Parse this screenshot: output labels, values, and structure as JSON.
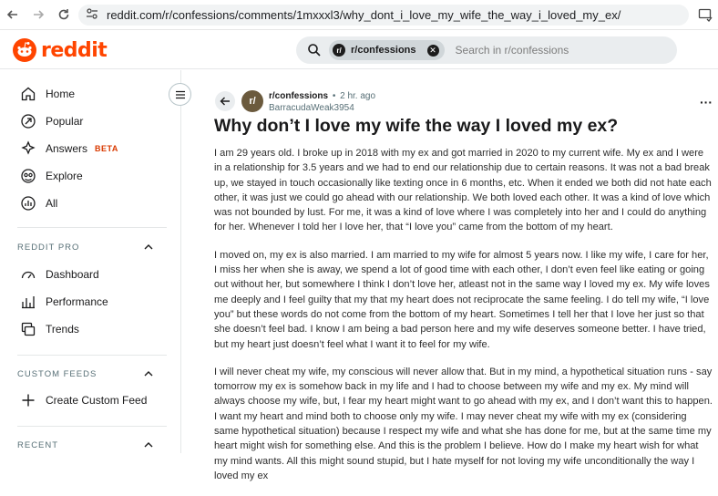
{
  "browser": {
    "url": "reddit.com/r/confessions/comments/1mxxxl3/why_dont_i_love_my_wife_the_way_i_loved_my_ex/"
  },
  "header": {
    "logo_text": "reddit",
    "search_chip": "r/confessions",
    "search_placeholder": "Search in r/confessions",
    "brand_color": "#ff4500"
  },
  "sidebar": {
    "nav": [
      {
        "label": "Home",
        "icon": "home-icon"
      },
      {
        "label": "Popular",
        "icon": "popular-icon"
      },
      {
        "label": "Answers",
        "icon": "answers-icon",
        "badge": "BETA"
      },
      {
        "label": "Explore",
        "icon": "explore-icon"
      },
      {
        "label": "All",
        "icon": "all-icon"
      }
    ],
    "sections": {
      "reddit_pro": {
        "title": "REDDIT PRO",
        "items": [
          {
            "label": "Dashboard",
            "icon": "dashboard-icon"
          },
          {
            "label": "Performance",
            "icon": "performance-icon"
          },
          {
            "label": "Trends",
            "icon": "trends-icon"
          }
        ]
      },
      "custom_feeds": {
        "title": "CUSTOM FEEDS",
        "items": [
          {
            "label": "Create Custom Feed",
            "icon": "plus-icon"
          }
        ]
      },
      "recent": {
        "title": "RECENT"
      }
    }
  },
  "post": {
    "subreddit": "r/confessions",
    "separator": "•",
    "age": "2 hr. ago",
    "author": "BarracudaWeak3954",
    "title": "Why don’t I love my wife the way I loved my ex?",
    "paragraphs": [
      "I am 29 years old. I broke up in 2018 with my ex and got married in 2020 to my current wife. My ex and I were in a relationship for 3.5 years and we had to end our relationship due to certain reasons. It was not a bad break up, we stayed in touch occasionally like texting once in 6 months, etc. When it ended we both did not hate each other, it was just we could go ahead with our relationship. We both loved each other. It was a kind of love which was not bounded by lust. For me, it was a kind of love where I was completely into her and I could do anything for her. Whenever I told her I love her, that “I love you” came from the bottom of my heart.",
      "I moved on, my ex is also married. I am married to my wife for almost 5 years now. I like my wife, I care for her, I miss her when she is away, we spend a lot of good time with each other, I don’t even feel like eating or going out without her, but somewhere I think I don’t love her, atleast not in the same way I loved my ex. My wife loves me deeply and I feel guilty that my that my heart does not reciprocate the same feeling. I do tell my wife, “I love you” but these words do not come from the bottom of my heart. Sometimes I tell her that I love her just so that she doesn’t feel bad. I know I am being a bad person here and my wife deserves someone better. I have tried, but my heart just doesn’t feel what I want it to feel for my wife.",
      "I will never cheat my wife, my conscious will never allow that. But in my mind, a hypothetical situation runs - say tomorrow my ex is somehow back in my life and I had to choose between my wife and my ex. My mind will always choose my wife, but, I fear my heart might want to go ahead with my ex, and I don’t want this to happen. I want my heart and mind both to choose only my wife. I may never cheat my wife with my ex (considering same hypothetical situation) because I respect my wife and what she has done for me, but at the same time my heart might wish for something else. And this is the problem I believe. How do I make my heart wish for what my mind wants. All this might sound stupid, but I hate myself for not loving my wife unconditionally the way I loved my ex"
    ]
  }
}
